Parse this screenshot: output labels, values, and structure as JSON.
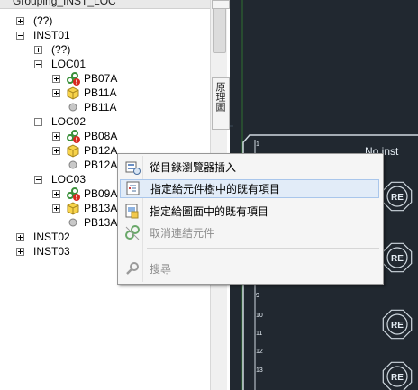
{
  "panel": {
    "title": "Grouping_INST_LOC"
  },
  "tree": [
    {
      "label": "(??)",
      "kind": "group",
      "expander": "plus"
    },
    {
      "label": "INST01",
      "kind": "group",
      "expander": "minus"
    },
    {
      "label": "(??)",
      "kind": "group",
      "expander": "plus"
    },
    {
      "label": "LOC01",
      "kind": "group",
      "expander": "minus"
    },
    {
      "label": "PB07A",
      "kind": "device-linked-warning",
      "expander": "plus"
    },
    {
      "label": "PB11A",
      "kind": "device-box",
      "expander": "plus"
    },
    {
      "label": "PB11A",
      "kind": "device-circle",
      "expander": "none"
    },
    {
      "label": "LOC02",
      "kind": "group",
      "expander": "minus"
    },
    {
      "label": "PB08A",
      "kind": "device-linked-warning",
      "expander": "plus"
    },
    {
      "label": "PB12A",
      "kind": "device-box",
      "expander": "plus"
    },
    {
      "label": "PB12A",
      "kind": "device-circle",
      "expander": "none"
    },
    {
      "label": "LOC03",
      "kind": "group",
      "expander": "minus"
    },
    {
      "label": "PB09A",
      "kind": "device-linked-warning",
      "expander": "plus"
    },
    {
      "label": "PB13A",
      "kind": "device-box",
      "expander": "plus"
    },
    {
      "label": "PB13A",
      "kind": "device-circle",
      "expander": "none"
    },
    {
      "label": "INST02",
      "kind": "group",
      "expander": "plus"
    },
    {
      "label": "INST03",
      "kind": "group",
      "expander": "plus"
    }
  ],
  "side_tab": {
    "label": "原理圖"
  },
  "context_menu": {
    "items": [
      {
        "label": "從目錄瀏覽器插入",
        "icon": "catalog-insert-icon",
        "enabled": true,
        "highlighted": false
      },
      {
        "label": "指定給元件樹中的既有項目",
        "icon": "tree-assign-icon",
        "enabled": true,
        "highlighted": true
      },
      {
        "label": "指定給圖面中的既有項目",
        "icon": "drawing-assign-icon",
        "enabled": true,
        "highlighted": false
      },
      {
        "label": "取消連結元件",
        "icon": "unlink-icon",
        "enabled": false,
        "highlighted": false
      },
      {
        "label": "搜尋",
        "icon": "search-icon",
        "enabled": false,
        "highlighted": false
      }
    ]
  },
  "canvas": {
    "title_fragment": "No inst",
    "row_numbers": [
      "1",
      "9",
      "10",
      "11",
      "12",
      "13"
    ],
    "symbol_text": "RE",
    "colors": {
      "background": "#212830",
      "line": "#cfd8df",
      "grid": "#3a4a57",
      "accent": "#2f6f2f"
    }
  }
}
